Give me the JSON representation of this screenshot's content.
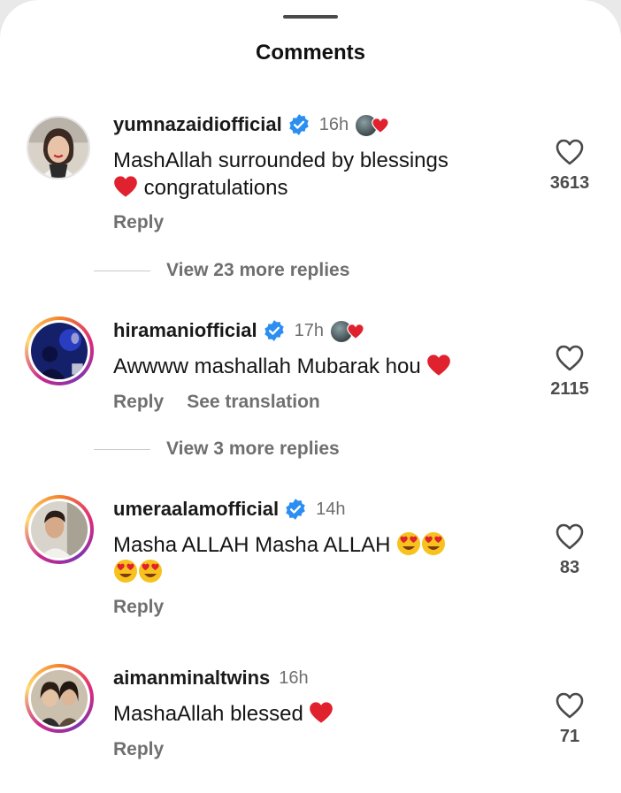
{
  "sheet": {
    "title": "Comments"
  },
  "comments": [
    {
      "username": "yumnazaidiofficial",
      "time": "16h",
      "text_lines": [
        "MashAllah surrounded by blessings",
        "congratulations"
      ],
      "reply_label": "Reply",
      "like_count": "3613",
      "view_replies": "View 23 more replies",
      "liked_by_creator": true
    },
    {
      "username": "hiramaniofficial",
      "time": "17h",
      "text": "Awwww mashallah Mubarak hou",
      "reply_label": "Reply",
      "translate_label": "See translation",
      "like_count": "2115",
      "view_replies": "View 3 more replies",
      "liked_by_creator": true
    },
    {
      "username": "umeraalamofficial",
      "time": "14h",
      "text": "Masha ALLAH Masha ALLAH",
      "reply_label": "Reply",
      "like_count": "83"
    },
    {
      "username": "aimanminaltwins",
      "time": "16h",
      "text": "MashaAllah blessed",
      "reply_label": "Reply",
      "like_count": "71"
    }
  ],
  "colors": {
    "verified_blue": "#2b8ef0",
    "heart_red": "#e0212e",
    "muted_text": "#6f6f6f",
    "story_ring": [
      "#f58529",
      "#dd2a7b",
      "#8134af",
      "#feda75"
    ]
  },
  "icons": {
    "verified": "verified-badge-icon",
    "like": "heart-outline-icon",
    "red_heart": "red-heart-emoji",
    "heart_eyes": "heart-eyes-emoji"
  }
}
